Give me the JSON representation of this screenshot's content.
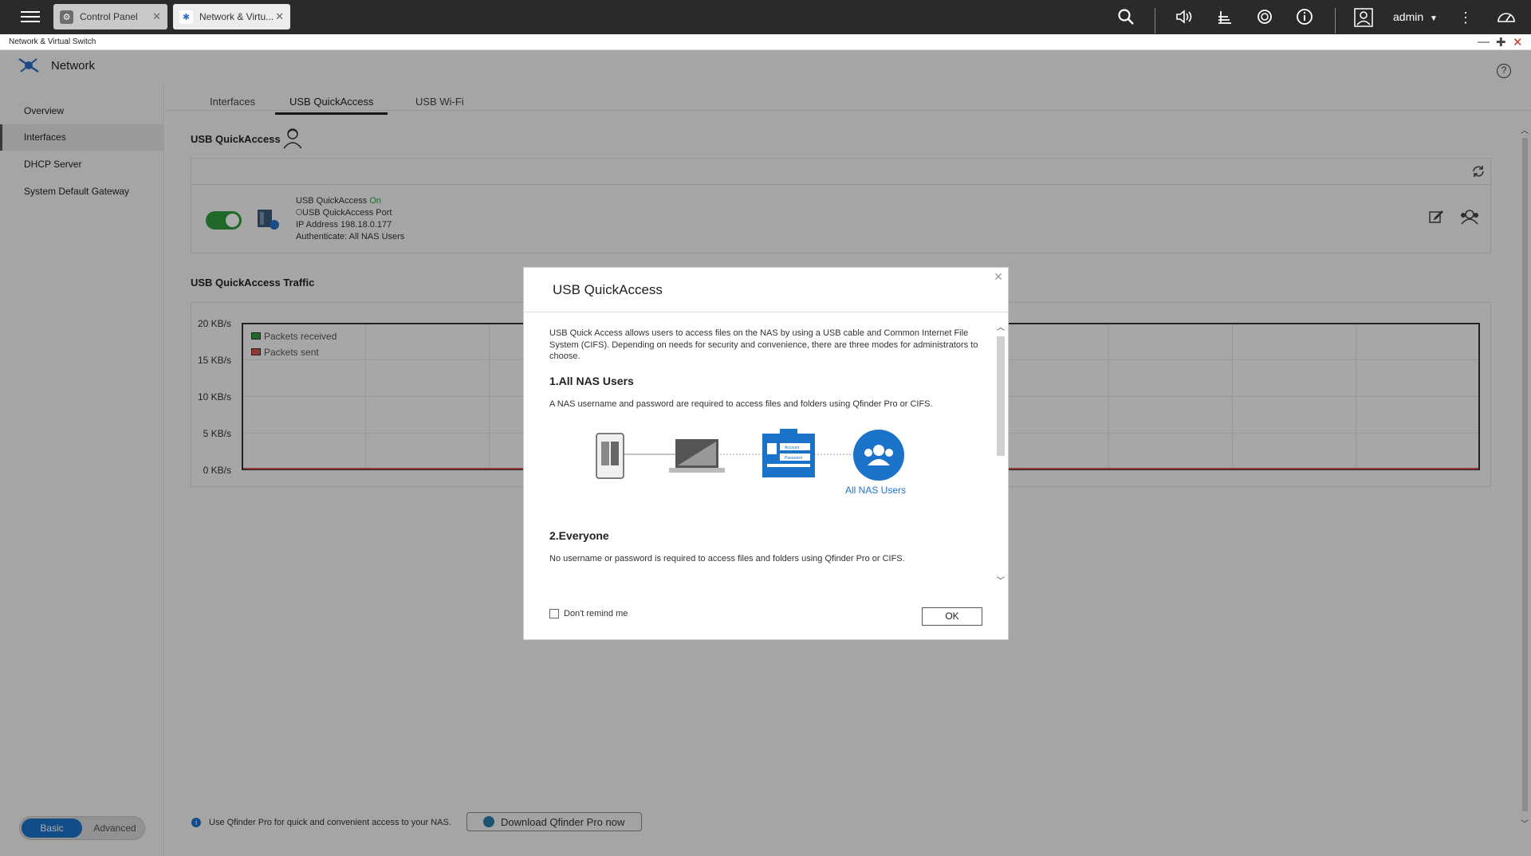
{
  "topbar": {
    "tabs": [
      {
        "label": "Control Panel"
      },
      {
        "label": "Network & Virtu..."
      }
    ],
    "user": "admin"
  },
  "window": {
    "title": "Network & Virtual Switch"
  },
  "app": {
    "name": "Network"
  },
  "sidebar": {
    "items": [
      {
        "label": "Overview"
      },
      {
        "label": "Interfaces"
      },
      {
        "label": "DHCP Server"
      },
      {
        "label": "System Default Gateway"
      }
    ],
    "mode_basic": "Basic",
    "mode_advanced": "Advanced"
  },
  "main": {
    "tabs": [
      {
        "label": "Interfaces"
      },
      {
        "label": "USB QuickAccess"
      },
      {
        "label": "USB Wi-Fi"
      }
    ],
    "section_title": "USB QuickAccess",
    "usb": {
      "status_label": "USB QuickAccess",
      "status_value": "On",
      "port": "USB QuickAccess Port",
      "ip": "IP Address 198.18.0.177",
      "auth": "Authenticate: All NAS Users"
    },
    "traffic_title": "USB QuickAccess Traffic",
    "bottom_note": "Use Qfinder Pro for quick and convenient access to your NAS.",
    "download_label": "Download Qfinder Pro now"
  },
  "chart_data": {
    "type": "line",
    "title": "",
    "ylabel": "",
    "y_ticks": [
      "20 KB/s",
      "15 KB/s",
      "10 KB/s",
      "5 KB/s",
      "0 KB/s"
    ],
    "ylim": [
      0,
      20
    ],
    "series": [
      {
        "name": "Packets received",
        "color": "#2e9a3c",
        "values": [
          0
        ]
      },
      {
        "name": "Packets sent",
        "color": "#d9534f",
        "values": [
          0
        ]
      }
    ]
  },
  "dialog": {
    "title": "USB QuickAccess",
    "intro": "USB Quick Access allows users to access files on the NAS by using a USB cable and Common Internet File System (CIFS). Depending on needs for security and convenience, there are three modes for administrators to choose.",
    "mode1_title": "1.All NAS Users",
    "mode1_desc": "A NAS username and password are required to access files and folders using Qfinder Pro or CIFS.",
    "mode1_caption": "All NAS Users",
    "card_account": "Account",
    "card_password": "Password",
    "mode2_title": "2.Everyone",
    "mode2_desc": "No username or password is required to access files and folders using Qfinder Pro or CIFS.",
    "dont_remind": "Don't remind me",
    "ok": "OK"
  },
  "colors": {
    "accent": "#1b72c9",
    "on_green": "#2e9a3c",
    "topbar": "#2a2a2a"
  }
}
